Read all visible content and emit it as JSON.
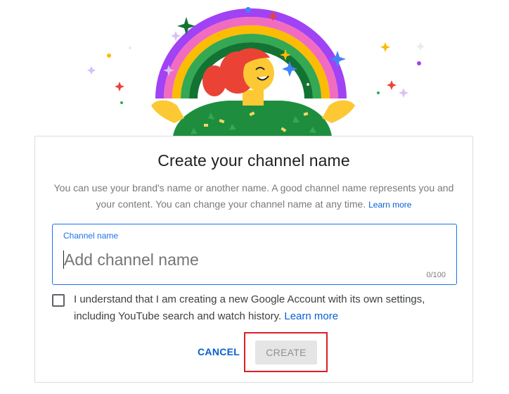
{
  "dialog": {
    "title": "Create your channel name",
    "description": "You can use your brand's name or another name. A good channel name represents you and your content. You can change your channel name at any time.",
    "learn_more_1": "Learn more",
    "channel_field": {
      "label": "Channel name",
      "value": "",
      "placeholder": "Add channel name",
      "counter": "0/100"
    },
    "consent": {
      "checked": false,
      "text": "I understand that I am creating a new Google Account with its own settings, including YouTube search and watch history.",
      "learn_more": "Learn more"
    },
    "cancel_label": "CANCEL",
    "create_label": "CREATE"
  },
  "colors": {
    "link_blue": "#065fd4",
    "focus_blue": "#1a73e8",
    "highlight_red": "#d91f26",
    "disabled_bg": "#e5e5e5",
    "disabled_text": "#909090"
  },
  "icons": {
    "hero": "celebration-illustration",
    "checkbox": "checkbox-unchecked"
  }
}
